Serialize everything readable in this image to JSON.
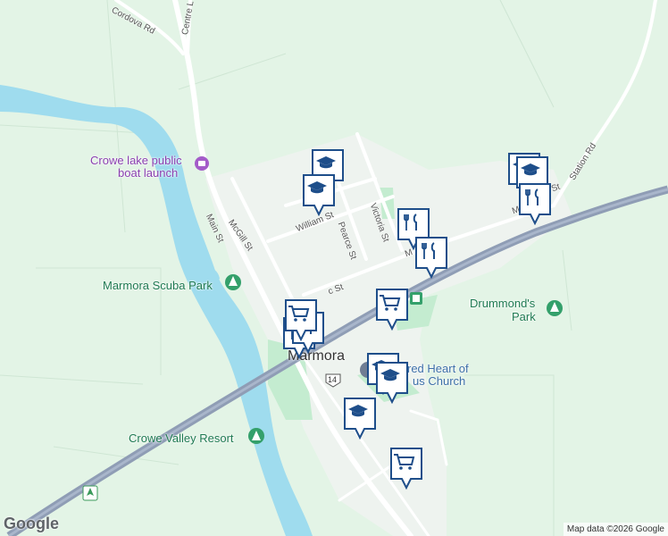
{
  "map": {
    "labels": {
      "boat_launch_line1": "Crowe lake public",
      "boat_launch_line2": "boat launch",
      "scuba_park": "Marmora Scuba Park",
      "drummonds_park_line1": "Drummond's",
      "drummonds_park_line2": "Park",
      "crowe_valley_resort": "Crowe Valley Resort",
      "church_line1": "red Heart of",
      "church_line2": "us Church",
      "town": "Marmora"
    },
    "streets": {
      "cordova_rd": "Cordova Rd",
      "centre_ln": "Centre L",
      "main_st": "Main St",
      "mcgill_st": "McGill St",
      "william_st": "William St",
      "pearce_st": "Pearce St",
      "victoria_st": "Victoria St",
      "forsyth_st": "c St",
      "station_rd": "Station Rd",
      "matthew_st": "M",
      "matthew_st2": "St",
      "ma_st": "M"
    },
    "highway_shield": "14",
    "attribution": "Map data ©2026 Google",
    "logo": "Google",
    "colors": {
      "land": "#e3f4e6",
      "park": "#c4ecd0",
      "water": "#9fdcee",
      "road": "#ffffff",
      "highway": "#8f9db5",
      "pin": "#1e4e8a"
    },
    "markers": [
      {
        "icon": "school-icon",
        "name": "school-marker"
      },
      {
        "icon": "school-icon",
        "name": "school-marker"
      },
      {
        "icon": "school-icon",
        "name": "school-marker"
      },
      {
        "icon": "school-icon",
        "name": "school-marker"
      },
      {
        "icon": "school-icon",
        "name": "school-marker"
      },
      {
        "icon": "restaurant-icon",
        "name": "restaurant-marker"
      },
      {
        "icon": "restaurant-icon",
        "name": "restaurant-marker"
      },
      {
        "icon": "restaurant-icon",
        "name": "restaurant-marker"
      },
      {
        "icon": "restaurant-icon",
        "name": "restaurant-marker"
      },
      {
        "icon": "grocery-icon",
        "name": "grocery-marker"
      },
      {
        "icon": "grocery-icon",
        "name": "grocery-marker"
      },
      {
        "icon": "grocery-icon",
        "name": "grocery-marker"
      }
    ]
  }
}
